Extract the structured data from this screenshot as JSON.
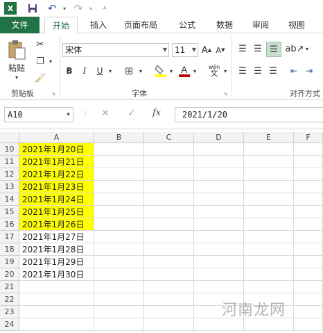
{
  "quick_access": {
    "save": "save",
    "undo": "undo",
    "redo": "redo"
  },
  "tabs": [
    "文件",
    "开始",
    "插入",
    "页面布局",
    "公式",
    "数据",
    "审阅",
    "视图"
  ],
  "ribbon": {
    "paste_label": "粘贴",
    "clipboard_group": "剪贴板",
    "font_group": "字体",
    "align_group": "对齐方式",
    "font_name": "宋体",
    "font_size": "11",
    "bold": "B",
    "italic": "I",
    "underline": "U",
    "wen": "wén",
    "wen_char": "文",
    "grow": "A",
    "shrink": "A"
  },
  "formula_bar": {
    "name_box": "A10",
    "fx": "fx",
    "formula": "2021/1/20"
  },
  "columns": [
    "A",
    "B",
    "C",
    "D",
    "E",
    "F"
  ],
  "rows": [
    {
      "num": "10",
      "a": "2021年1月20日",
      "highlight": true
    },
    {
      "num": "11",
      "a": "2021年1月21日",
      "highlight": true
    },
    {
      "num": "12",
      "a": "2021年1月22日",
      "highlight": true
    },
    {
      "num": "13",
      "a": "2021年1月23日",
      "highlight": true
    },
    {
      "num": "14",
      "a": "2021年1月24日",
      "highlight": true
    },
    {
      "num": "15",
      "a": "2021年1月25日",
      "highlight": true
    },
    {
      "num": "16",
      "a": "2021年1月26日",
      "highlight": true
    },
    {
      "num": "17",
      "a": "2021年1月27日",
      "highlight": false
    },
    {
      "num": "18",
      "a": "2021年1月28日",
      "highlight": false
    },
    {
      "num": "19",
      "a": "2021年1月29日",
      "highlight": false
    },
    {
      "num": "20",
      "a": "2021年1月30日",
      "highlight": false
    },
    {
      "num": "21",
      "a": "",
      "highlight": false
    },
    {
      "num": "22",
      "a": "",
      "highlight": false
    },
    {
      "num": "23",
      "a": "",
      "highlight": false
    },
    {
      "num": "24",
      "a": "",
      "highlight": false
    }
  ],
  "watermark": "河南龙网",
  "colors": {
    "accent": "#217346",
    "highlight": "#ffff00",
    "font_color": "#c00000"
  }
}
